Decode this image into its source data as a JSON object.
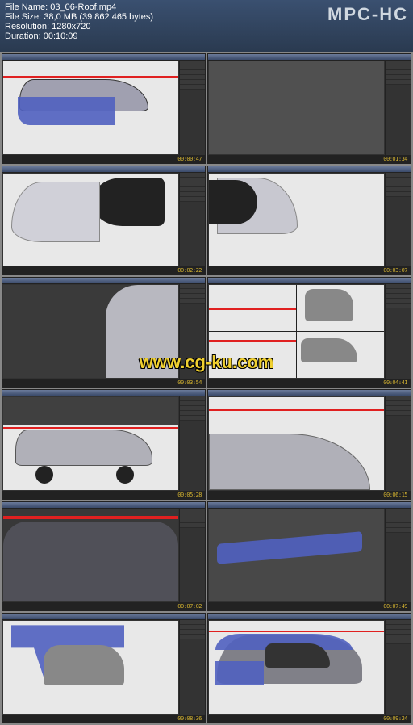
{
  "info": {
    "file_name_label": "File Name:",
    "file_name": "03_06-Roof.mp4",
    "file_size_label": "File Size:",
    "file_size": "38,0 MB (39 862 465 bytes)",
    "resolution_label": "Resolution:",
    "resolution": "1280x720",
    "duration_label": "Duration:",
    "duration": "00:10:09",
    "app_name": "MPC-HC"
  },
  "watermark": "www.cg-ku.com",
  "thumbnails": [
    {
      "timecode": "00:00:47",
      "desc": "side car blue mesh"
    },
    {
      "timecode": "00:01:34",
      "desc": "gray modeling plain"
    },
    {
      "timecode": "00:02:22",
      "desc": "black wire rear window"
    },
    {
      "timecode": "00:03:07",
      "desc": "rear pillar wire"
    },
    {
      "timecode": "00:03:54",
      "desc": "dark roof close"
    },
    {
      "timecode": "00:04:41",
      "desc": "four view car"
    },
    {
      "timecode": "00:05:28",
      "desc": "side car reference"
    },
    {
      "timecode": "00:06:15",
      "desc": "roof curve top"
    },
    {
      "timecode": "00:07:02",
      "desc": "dark roof mesh"
    },
    {
      "timecode": "00:07:49",
      "desc": "blue roof strip"
    },
    {
      "timecode": "00:08:36",
      "desc": "blue body pillar"
    },
    {
      "timecode": "00:09:24",
      "desc": "blue roof side"
    }
  ]
}
